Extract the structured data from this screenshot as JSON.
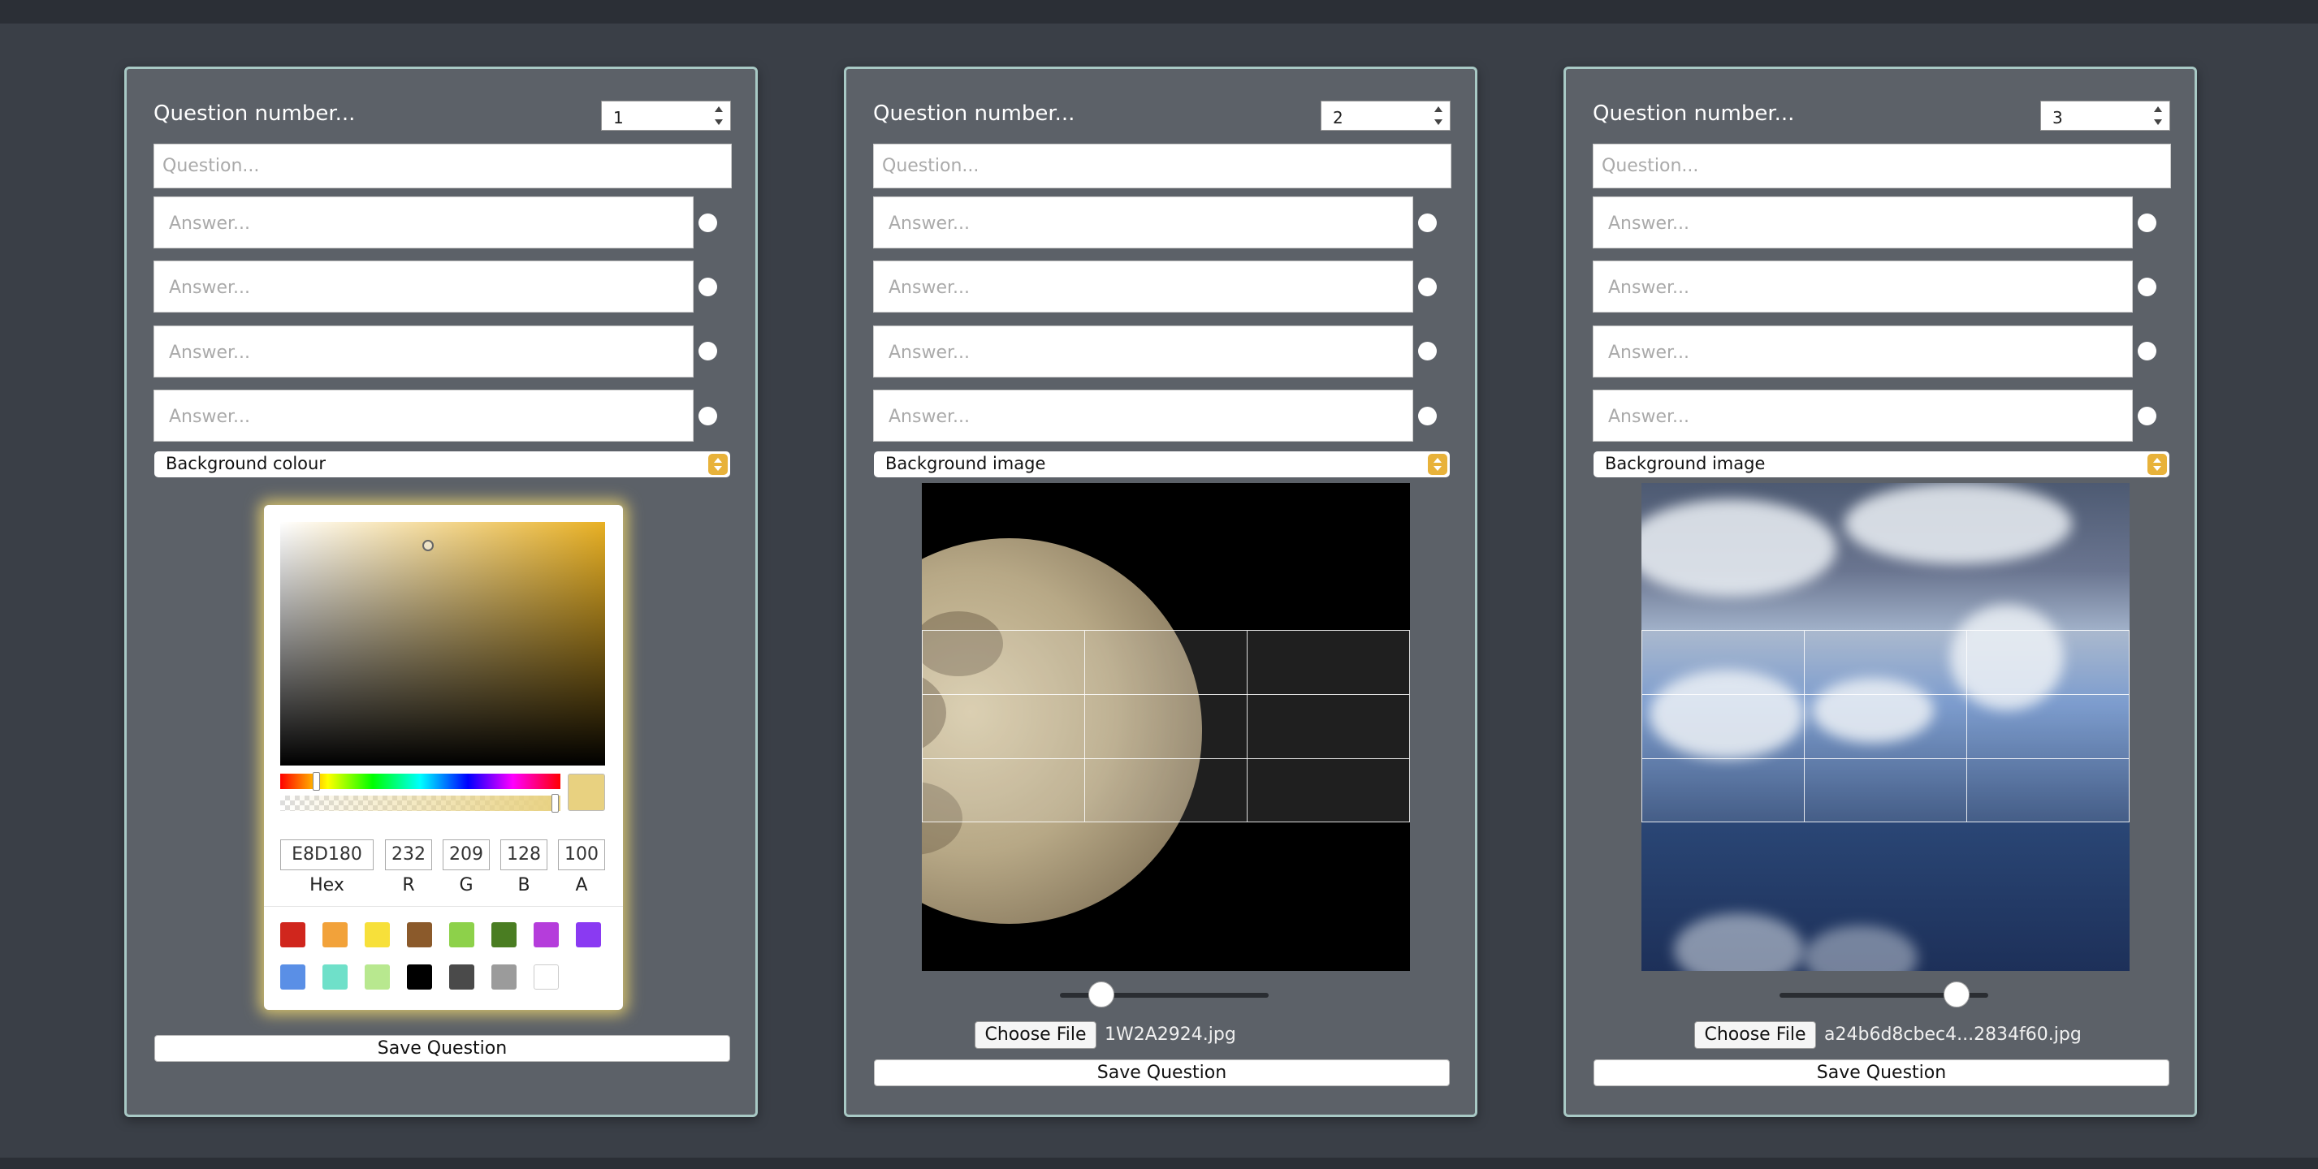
{
  "cards": [
    {
      "question_number_label": "Question number...",
      "question_number_value": "1",
      "question_placeholder": "Question...",
      "answers": [
        "Answer...",
        "Answer...",
        "Answer...",
        "Answer..."
      ],
      "background_mode": "Background colour",
      "color_picker": {
        "hex": "E8D180",
        "r": "232",
        "g": "209",
        "b": "128",
        "a": "100",
        "labels": {
          "hex": "Hex",
          "r": "R",
          "g": "G",
          "b": "B",
          "a": "A"
        },
        "selected_color": "#e8d180",
        "swatches_row1": [
          "#d0261d",
          "#f2a23a",
          "#f7e03a",
          "#8b5a2b",
          "#8dd14a",
          "#4a7d22",
          "#b53ddb",
          "#8a3af2"
        ],
        "swatches_row2": [
          "#5a8fe6",
          "#6fe0c9",
          "#b8e88f",
          "#000000",
          "#4a4a4a",
          "#9b9b9b",
          "#ffffff"
        ]
      },
      "save_label": "Save Question"
    },
    {
      "question_number_label": "Question number...",
      "question_number_value": "2",
      "question_placeholder": "Question...",
      "answers": [
        "Answer...",
        "Answer...",
        "Answer...",
        "Answer..."
      ],
      "background_mode": "Background image",
      "file_button": "Choose File",
      "file_name": "1W2A2924.jpg",
      "slider_value": 0.2,
      "save_label": "Save Question"
    },
    {
      "question_number_label": "Question number...",
      "question_number_value": "3",
      "question_placeholder": "Question...",
      "answers": [
        "Answer...",
        "Answer...",
        "Answer...",
        "Answer..."
      ],
      "background_mode": "Background image",
      "file_button": "Choose File",
      "file_name": "a24b6d8cbec4...2834f60.jpg",
      "slider_value": 0.85,
      "save_label": "Save Question"
    }
  ],
  "theme": {
    "page_bg": "#3a3f47",
    "card_bg": "#5c6168",
    "card_border": "#a8c9c5",
    "accent": "#e8b23a"
  }
}
